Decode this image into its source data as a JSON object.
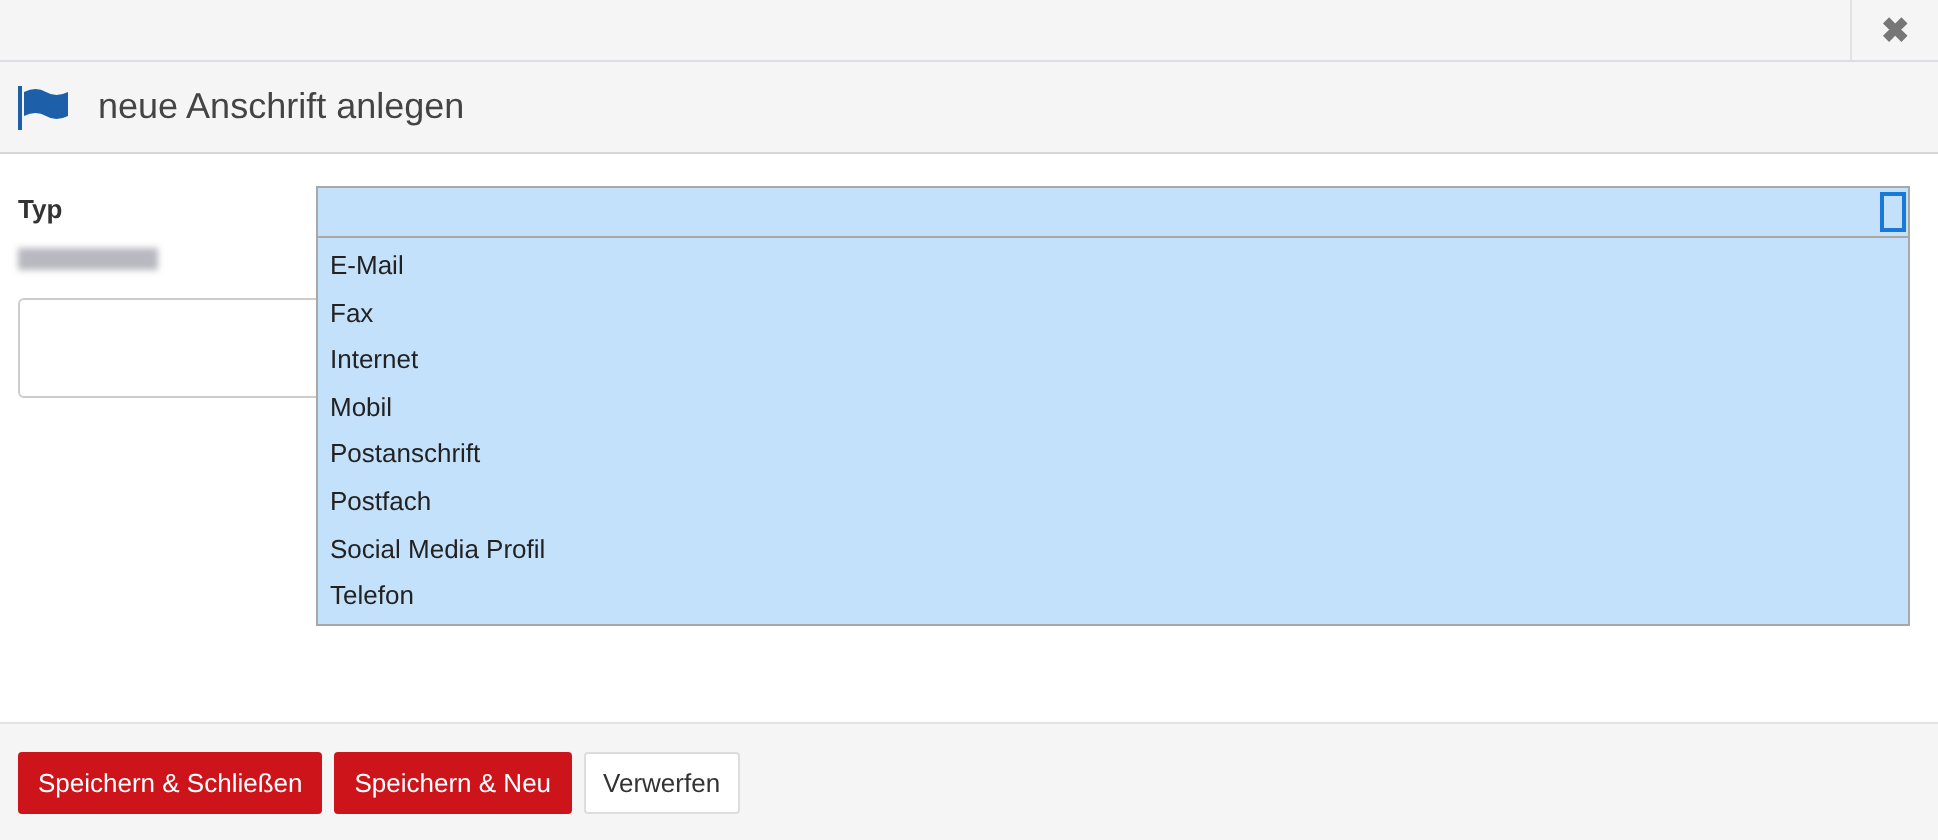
{
  "close_button": {
    "label": "✖"
  },
  "dialog": {
    "title": "neue Anschrift anlegen"
  },
  "form": {
    "type_field": {
      "label": "Typ",
      "expanded": true,
      "options": [
        "E-Mail",
        "Fax",
        "Internet",
        "Mobil",
        "Postanschrift",
        "Postfach",
        "Social Media Profil",
        "Telefon"
      ]
    }
  },
  "buttons": [
    {
      "label": "Speichern & Schließen",
      "kind": "primary"
    },
    {
      "label": "Speichern & Neu",
      "kind": "primary"
    },
    {
      "label": "Verwerfen",
      "kind": "default"
    }
  ]
}
